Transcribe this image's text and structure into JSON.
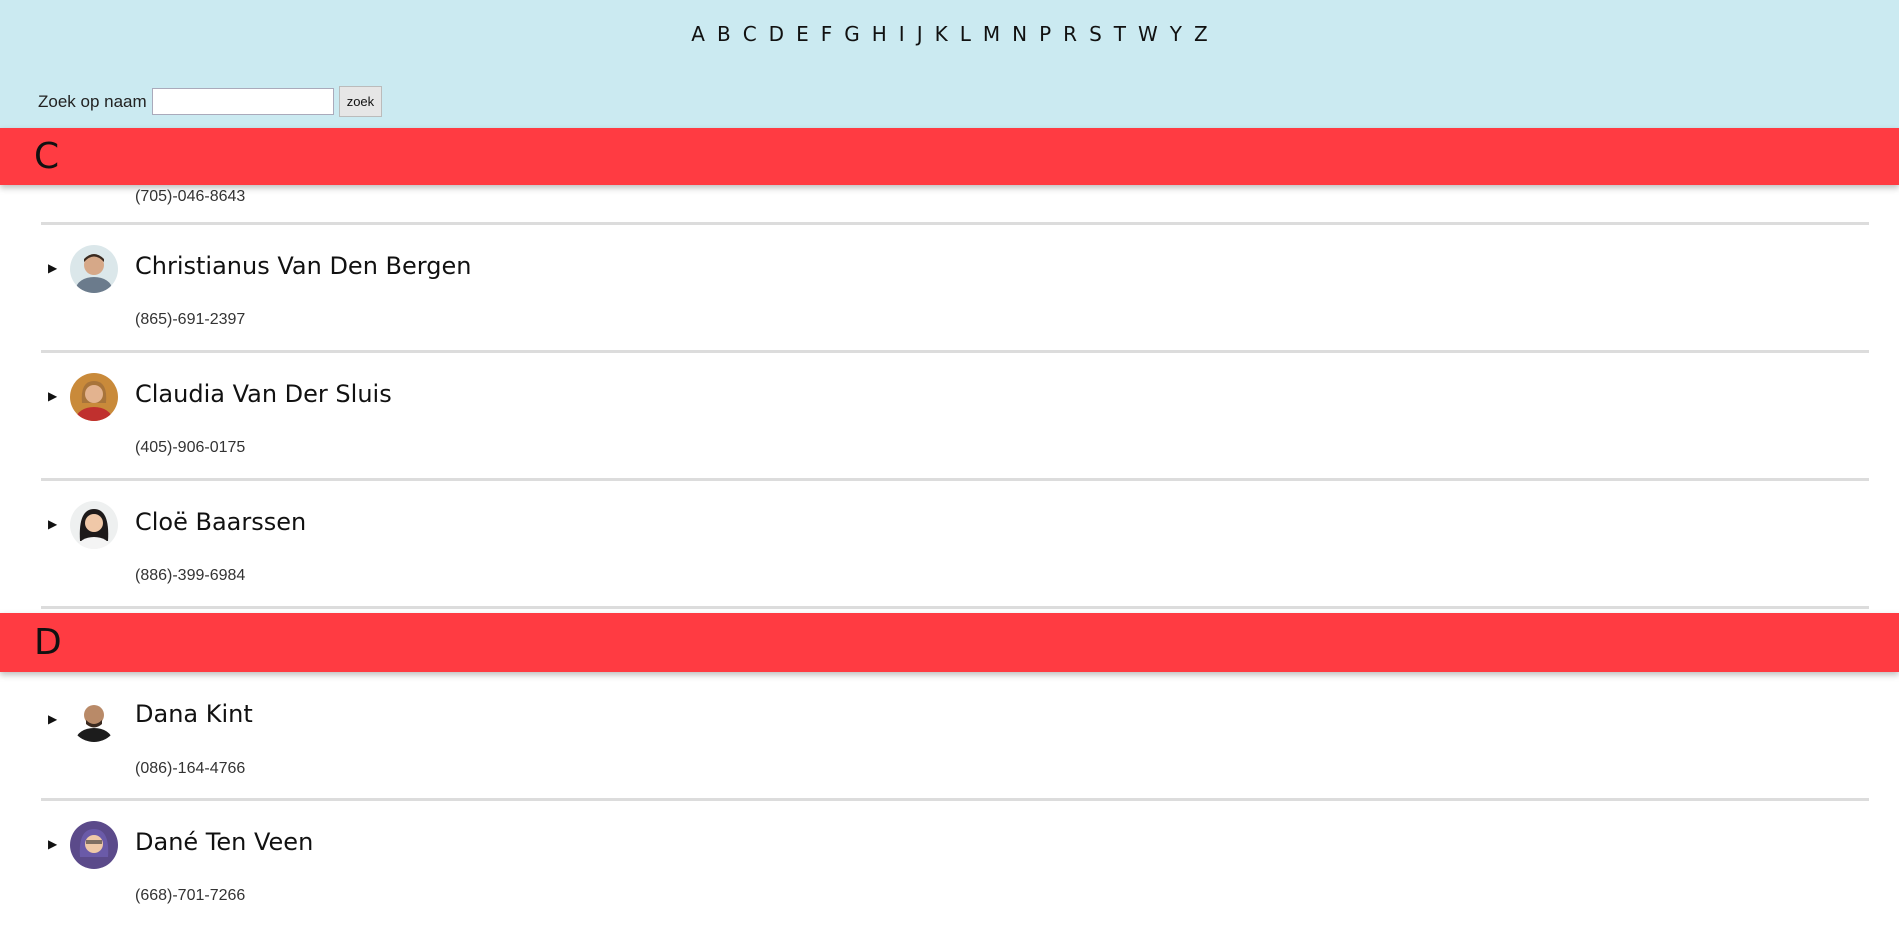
{
  "alphabet": [
    "A",
    "B",
    "C",
    "D",
    "E",
    "F",
    "G",
    "H",
    "I",
    "J",
    "K",
    "L",
    "M",
    "N",
    "P",
    "R",
    "S",
    "T",
    "W",
    "Y",
    "Z"
  ],
  "search": {
    "label": "Zoek op naam",
    "value": "",
    "placeholder": "",
    "button_label": "zoek"
  },
  "sections": {
    "c": {
      "letter": "C",
      "partial_phone": "(705)-046-8643",
      "contacts": [
        {
          "name": "Christianus Van Den Bergen",
          "phone": "(865)-691-2397"
        },
        {
          "name": "Claudia Van Der Sluis",
          "phone": "(405)-906-0175"
        },
        {
          "name": "Cloë Baarssen",
          "phone": "(886)-399-6984"
        }
      ]
    },
    "d": {
      "letter": "D",
      "contacts": [
        {
          "name": "Dana Kint",
          "phone": "(086)-164-4766"
        },
        {
          "name": "Dané Ten Veen",
          "phone": "(668)-701-7266"
        }
      ]
    }
  },
  "colors": {
    "header_bg": "#cbeaf1",
    "letter_band": "#ff3b42",
    "divider": "#dcdcdc"
  },
  "icons": {
    "expand": "triangle-right-icon",
    "avatar": "avatar"
  }
}
